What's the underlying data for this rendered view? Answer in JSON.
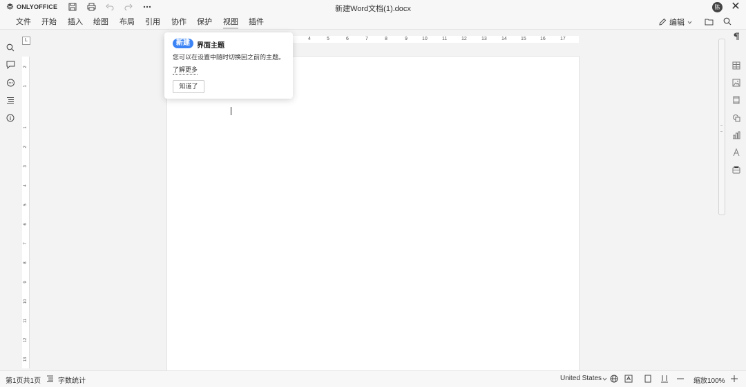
{
  "app": {
    "logo_text": "ONLYOFFICE",
    "doc_title": "新建Word文档(1).docx",
    "avatar_initial": "陈"
  },
  "quick_access": [
    "save-icon",
    "print-icon",
    "undo-icon",
    "redo-icon",
    "more-icon"
  ],
  "menu": {
    "items": [
      "文件",
      "开始",
      "插入",
      "绘图",
      "布局",
      "引用",
      "协作",
      "保护",
      "视图",
      "插件"
    ],
    "active": "视图",
    "edit_mode_label": "编辑"
  },
  "popup": {
    "badge": "新建",
    "title": "界面主题",
    "description": "您可以在设置中随时切换回之前的主题。",
    "link": "了解更多",
    "button": "知道了"
  },
  "ruler": {
    "h_numbers": [
      "4",
      "5",
      "6",
      "7",
      "8",
      "9",
      "10",
      "11",
      "12",
      "13",
      "14",
      "15",
      "16",
      "17"
    ],
    "v_numbers": [
      "2",
      "1",
      "1",
      "2",
      "3",
      "4",
      "5",
      "6",
      "7",
      "8",
      "9",
      "10",
      "11",
      "12",
      "13"
    ],
    "tab_stop": "L"
  },
  "status": {
    "page_info": "第1页共1页",
    "word_count": "字数统计",
    "language": "United States",
    "zoom": "缩放100%"
  },
  "colors": {
    "accent": "#3c84f5",
    "toolbar_bg": "#f7f7f7",
    "workspace_bg": "#f3f3f3"
  }
}
